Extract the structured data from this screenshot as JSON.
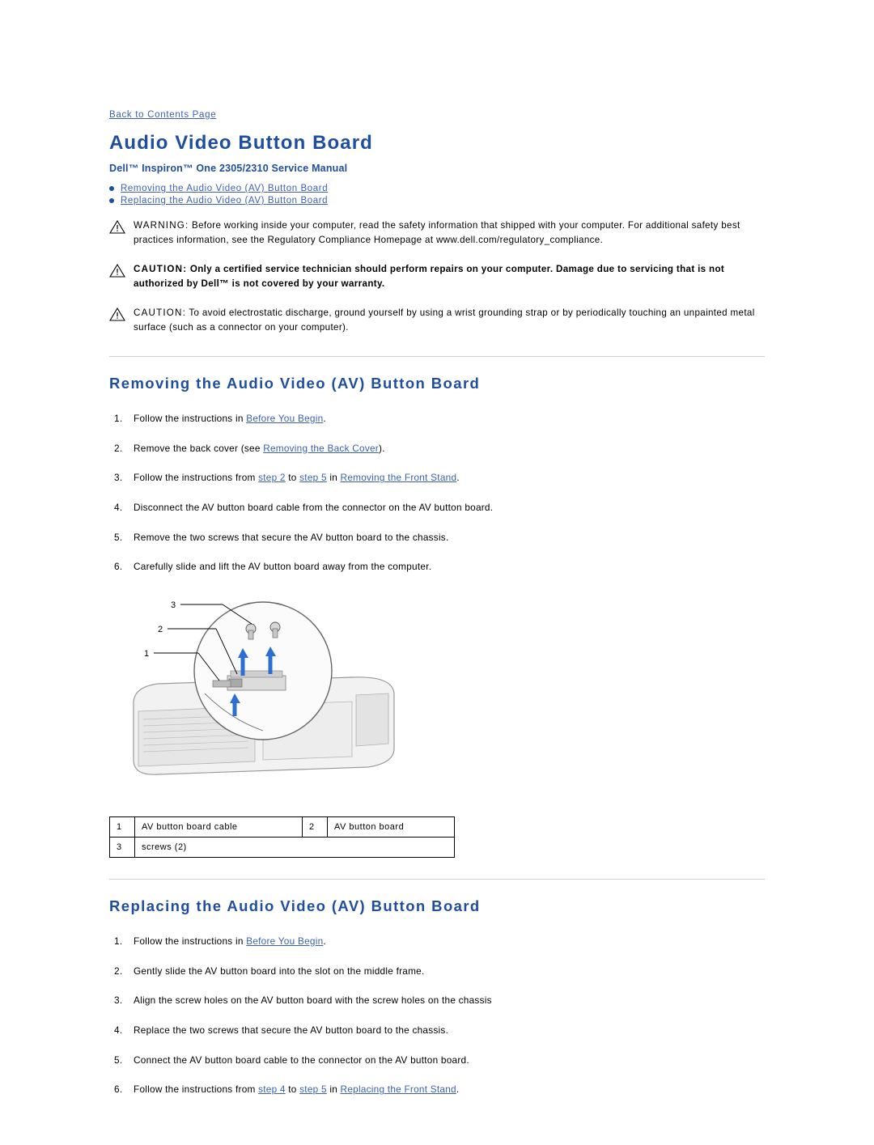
{
  "back_link": "Back to Contents Page",
  "title": "Audio Video Button Board",
  "subtitle": "Dell™ Inspiron™ One 2305/2310 Service Manual",
  "toc": [
    {
      "label": "Removing the Audio Video (AV) Button Board"
    },
    {
      "label": "Replacing the Audio Video (AV) Button Board"
    }
  ],
  "notices": [
    {
      "lead": "WARNING:",
      "text": " Before working inside your computer, read the safety information that shipped with your computer. For additional safety best practices information, see the Regulatory Compliance Homepage at www.dell.com/regulatory_compliance.",
      "bold": false
    },
    {
      "lead": "CAUTION:",
      "text": " Only a certified service technician should perform repairs on your computer. Damage due to servicing that is not authorized by Dell™ is not covered by your warranty.",
      "bold": true
    },
    {
      "lead": "CAUTION:",
      "text": " To avoid electrostatic discharge, ground yourself by using a wrist grounding strap or by periodically touching an unpainted metal surface (such as a connector on your computer).",
      "bold": false
    }
  ],
  "removing": {
    "heading": "Removing the Audio Video (AV) Button Board",
    "steps": [
      {
        "pre": "Follow the instructions in ",
        "link": "Before You Begin",
        "post": "."
      },
      {
        "pre": "Remove the back cover (see ",
        "link": "Removing the Back Cover",
        "post": ")."
      },
      {
        "pre": "Follow the instructions from ",
        "link": "step 2",
        "mid": " to ",
        "link2": "step 5",
        "mid2": " in ",
        "link3": "Removing the Front Stand",
        "post": "."
      },
      {
        "pre": "Disconnect the AV button board cable from the connector on the AV button board.",
        "link": "",
        "post": ""
      },
      {
        "pre": "Remove the two screws that secure the AV button board to the chassis.",
        "link": "",
        "post": ""
      },
      {
        "pre": "Carefully slide and lift the AV button board away from the computer.",
        "link": "",
        "post": ""
      }
    ],
    "callouts": [
      "1",
      "2",
      "3"
    ],
    "legend": [
      {
        "num": "1",
        "label": "AV button board cable",
        "num2": "2",
        "label2": "AV button board"
      },
      {
        "num": "3",
        "label": "screws (2)",
        "num2": "",
        "label2": ""
      }
    ]
  },
  "replacing": {
    "heading": "Replacing the Audio Video (AV) Button Board",
    "steps": [
      {
        "pre": "Follow the instructions in ",
        "link": "Before You Begin",
        "post": "."
      },
      {
        "pre": "Gently slide the AV button board into the slot on the middle frame.",
        "link": "",
        "post": ""
      },
      {
        "pre": "Align the screw holes on the AV button board with the screw holes on the chassis",
        "link": "",
        "post": ""
      },
      {
        "pre": "Replace the two screws that secure the AV button board to the chassis.",
        "link": "",
        "post": ""
      },
      {
        "pre": "Connect the AV button board cable to the connector on the AV button board.",
        "link": "",
        "post": ""
      },
      {
        "pre": "Follow the instructions from ",
        "link": "step 4",
        "mid": " to ",
        "link2": "step 5",
        "mid2": " in ",
        "link3": "Replacing the Front Stand",
        "post": "."
      }
    ]
  },
  "colors": {
    "heading_blue": "#1f4ea1",
    "link_blue": "#3b5fb5",
    "arrow_blue": "#2b6fd4"
  }
}
